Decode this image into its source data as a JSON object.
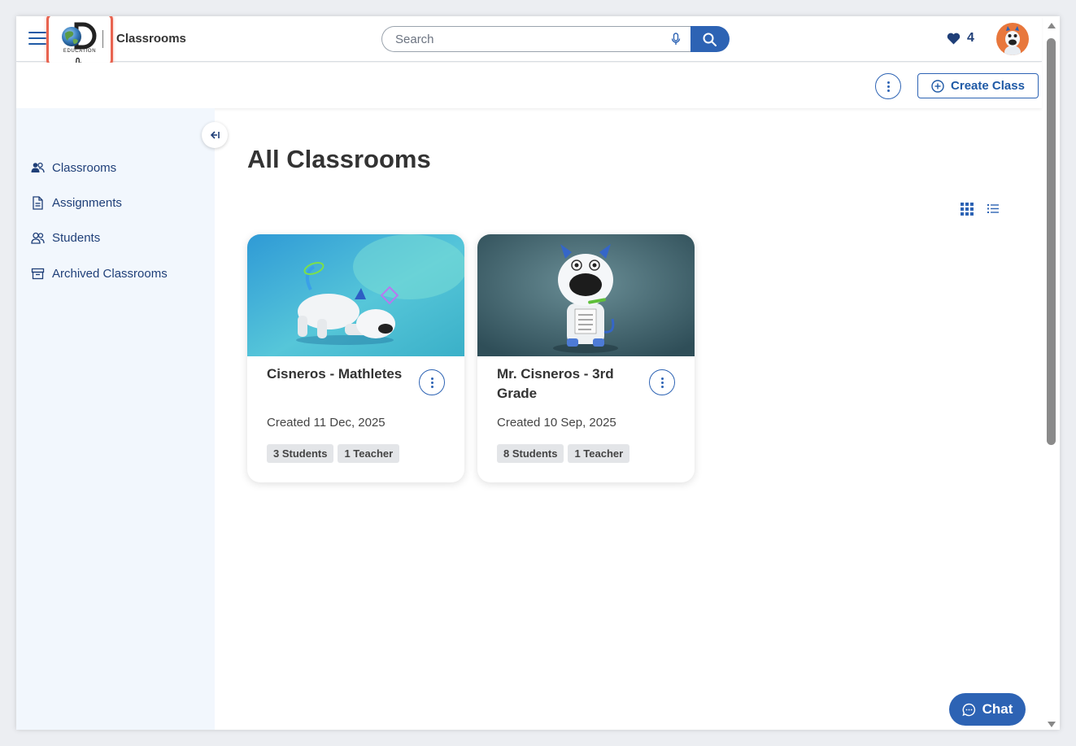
{
  "header": {
    "logo_text": "EDUCATION",
    "title": "Classrooms",
    "search_placeholder": "Search",
    "hearts_count": "4"
  },
  "toolbar": {
    "create_label": "Create Class"
  },
  "sidebar": {
    "items": [
      {
        "label": "Classrooms",
        "icon": "classrooms-icon"
      },
      {
        "label": "Assignments",
        "icon": "assignments-icon"
      },
      {
        "label": "Students",
        "icon": "students-icon"
      },
      {
        "label": "Archived Classrooms",
        "icon": "archive-icon"
      }
    ]
  },
  "main": {
    "title": "All Classrooms",
    "cards": [
      {
        "title": "Cisneros - Mathletes",
        "created": "Created 11 Dec, 2025",
        "students": "3 Students",
        "teachers": "1 Teacher"
      },
      {
        "title": "Mr. Cisneros - 3rd Grade",
        "created": "Created 10 Sep, 2025",
        "students": "8 Students",
        "teachers": "1 Teacher"
      }
    ]
  },
  "chat": {
    "label": "Chat"
  },
  "colors": {
    "primary": "#2d63b4",
    "nav_text": "#1f3f78",
    "sidebar_bg": "#f2f7fd",
    "highlight": "#e8634f"
  }
}
